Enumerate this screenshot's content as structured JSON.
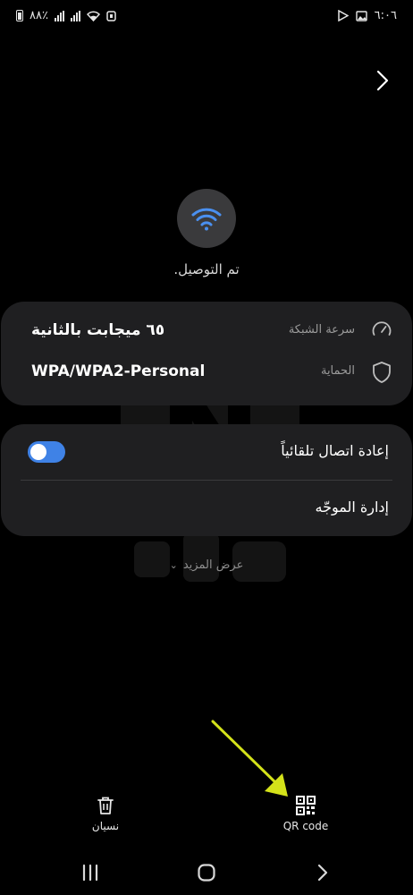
{
  "status_bar": {
    "battery": "٨٨٪",
    "time": "٦:٠٦"
  },
  "network": {
    "status": "تم التوصيل."
  },
  "details": {
    "speed_label": "سرعة الشبكة",
    "speed_value": "٦٥ ميجابت بالثانية",
    "security_label": "الحماية",
    "security_value": "WPA/WPA2-Personal"
  },
  "settings": {
    "auto_reconnect_label": "إعادة اتصال تلقائياً",
    "auto_reconnect_on": true,
    "manage_router_label": "إدارة الموجّه"
  },
  "show_more_label": "عرض المزيد",
  "bottom_actions": {
    "forget_label": "نسيان",
    "qr_label": "QR code"
  },
  "colors": {
    "accent": "#3f82e6",
    "wifi_icon": "#4a90f0",
    "card_bg": "#1f1f21",
    "annotation_arrow": "#d4e21a"
  },
  "icons": {
    "back": "chevron-right-icon",
    "wifi": "wifi-icon",
    "speed": "speedometer-icon",
    "security": "shield-icon",
    "forget": "trash-icon",
    "qr": "qr-code-icon"
  }
}
